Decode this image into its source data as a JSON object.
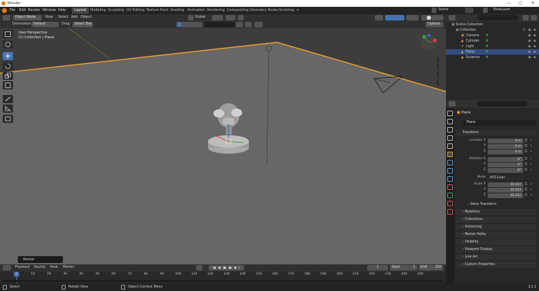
{
  "window": {
    "title": "Blender",
    "controls": [
      "—",
      "▢",
      "✕"
    ]
  },
  "menu": [
    "File",
    "Edit",
    "Render",
    "Window",
    "Help"
  ],
  "workspaces": [
    "Layout",
    "Modeling",
    "Sculpting",
    "UV Editing",
    "Texture Paint",
    "Shading",
    "Animation",
    "Rendering",
    "Compositing",
    "Geometry Nodes",
    "Scripting"
  ],
  "workspace_add": "+",
  "scene": {
    "label": "Scene",
    "view_layer": "ViewLayer"
  },
  "viewport_header": {
    "mode": "Object Mode",
    "view": "View",
    "select": "Select",
    "add": "Add",
    "object": "Object",
    "transform": "Global",
    "orientation_label": "Orientation:",
    "orientation_value": "Default",
    "drag_label": "Drag:",
    "drag_value": "Select Box",
    "options": "Options"
  },
  "viewport_overlay": {
    "perspective": "User Perspective",
    "collection": "(1) Collection | Plane"
  },
  "last_operator": "Resize",
  "outliner": {
    "root": "Scene Collection",
    "collection": "Collection",
    "items": [
      {
        "name": "Camera",
        "icon": "camera-icon",
        "selected": false
      },
      {
        "name": "Cylinder",
        "icon": "mesh-icon",
        "selected": false
      },
      {
        "name": "Light",
        "icon": "light-icon",
        "selected": false
      },
      {
        "name": "Plane",
        "icon": "mesh-icon",
        "selected": true
      },
      {
        "name": "Suzanne",
        "icon": "mesh-icon",
        "selected": false
      }
    ]
  },
  "properties": {
    "object_name": "Plane",
    "data_name": "Plane",
    "transform": "Transform",
    "location": {
      "label": "Location X",
      "x": "0 m",
      "y": "0 m",
      "z": "0 m"
    },
    "rotation": {
      "label": "Rotation X",
      "x": "0°",
      "y": "0°",
      "z": "0°"
    },
    "mode_label": "Mode",
    "mode_value": "XYZ Euler",
    "scale": {
      "label": "Scale X",
      "x": "35.537",
      "y": "35.537",
      "z": "35.537"
    },
    "axis_y": "Y",
    "axis_z": "Z",
    "panels": [
      "Delta Transform",
      "Relations",
      "Collections",
      "Instancing",
      "Motion Paths",
      "Visibility",
      "Viewport Display",
      "Line Art",
      "Custom Properties"
    ]
  },
  "timeline": {
    "playback": "Playback",
    "keying": "Keying",
    "view": "View",
    "marker": "Marker",
    "current_frame": "1",
    "start_label": "Start",
    "start": "1",
    "end_label": "End",
    "end": "250",
    "current_marker": "1",
    "ticks": [
      "10",
      "20",
      "30",
      "40",
      "50",
      "60",
      "70",
      "80",
      "90",
      "100",
      "110",
      "120",
      "130",
      "140",
      "150",
      "160",
      "170",
      "180",
      "190",
      "200",
      "210",
      "220",
      "230",
      "240",
      "250"
    ]
  },
  "status": {
    "select": "Select",
    "rotate": "Rotate View",
    "context": "Object Context Menu",
    "version": "3.2.1"
  },
  "colors": {
    "accent": "#4772b3",
    "selection_orange": "#e89c2c",
    "background": "#3d3d3d"
  }
}
